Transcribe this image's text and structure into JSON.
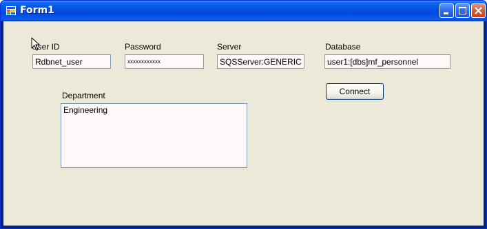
{
  "window": {
    "title": "Form1",
    "accent": "#0054e3",
    "client_bg": "#ece9d8"
  },
  "fields": {
    "user_id": {
      "label": "User ID",
      "value": "Rdbnet_user"
    },
    "password": {
      "label": "Password",
      "value": "xxxxxxxxxxxx"
    },
    "server": {
      "label": "Server",
      "value": "SQSServer:GENERIC"
    },
    "database": {
      "label": "Database",
      "value": "user1:[dbs]mf_personnel"
    },
    "department": {
      "label": "Department",
      "value": "Engineering"
    }
  },
  "buttons": {
    "connect": "Connect"
  },
  "icons": [
    "app-icon",
    "minimize-icon",
    "maximize-icon",
    "close-icon",
    "mouse-cursor-icon"
  ]
}
